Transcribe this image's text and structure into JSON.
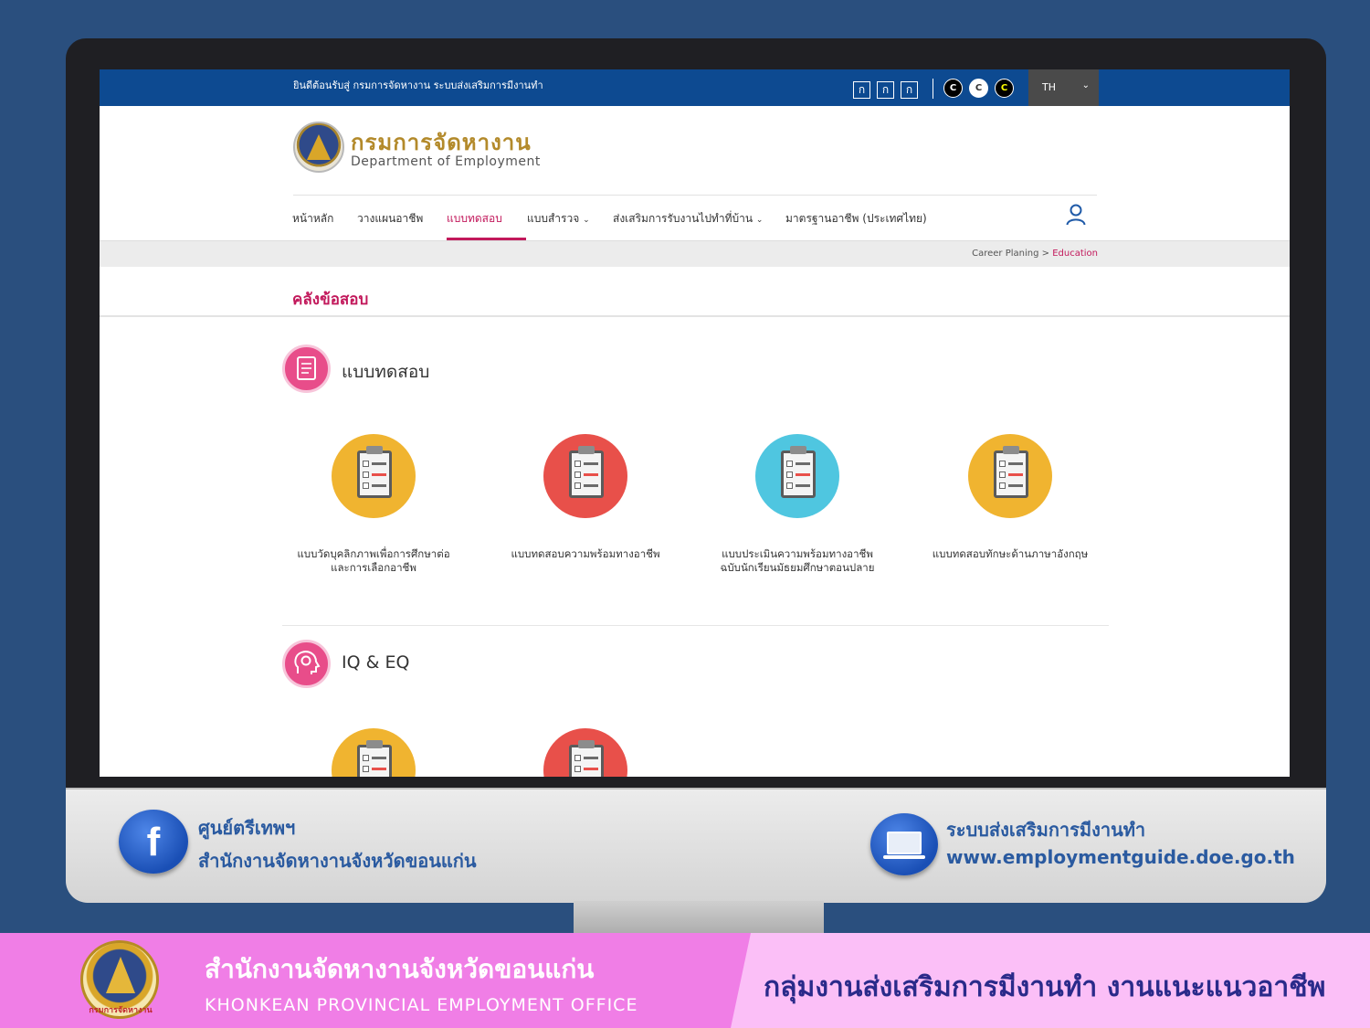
{
  "topbar": {
    "welcome": "ยินดีต้อนรับสู่ กรมการจัดหางาน ระบบส่งเสริมการมีงานทำ",
    "font_sizes": [
      "ก",
      "ก",
      "ก"
    ],
    "contrast": [
      "C",
      "C",
      "C"
    ],
    "language": "TH"
  },
  "brand": {
    "name_th": "กรมการจัดหางาน",
    "name_en": "Department of Employment"
  },
  "nav": {
    "items": [
      "หน้าหลัก",
      "วางแผนอาชีพ",
      "แบบทดสอบ",
      "แบบสำรวจ",
      "ส่งเสริมการรับงานไปทำที่บ้าน",
      "มาตรฐานอาชีพ (ประเทศไทย)"
    ],
    "active": "แบบทดสอบ"
  },
  "breadcrumb": {
    "parent": "Career Planing",
    "separator": ">",
    "current": "Education"
  },
  "page_title": "คลังข้อสอบ",
  "sections": [
    {
      "title": "แบบทดสอบ",
      "icon": "test-paper-icon",
      "cards": [
        {
          "label": "แบบวัดบุคลิกภาพเพื่อการศึกษาต่อและการเลือกอาชีพ",
          "color": "#f0b430"
        },
        {
          "label": "แบบทดสอบความพร้อมทางอาชีพ",
          "color": "#e8504a"
        },
        {
          "label": "แบบประเมินความพร้อมทางอาชีพ ฉบับนักเรียนมัธยมศึกษาตอนปลาย",
          "color": "#4fc6e0"
        },
        {
          "label": "แบบทดสอบทักษะด้านภาษาอังกฤษ",
          "color": "#f0b430"
        }
      ]
    },
    {
      "title": "IQ & EQ",
      "icon": "brain-gear-icon",
      "cards": [
        {
          "label": "",
          "color": "#f0b430"
        },
        {
          "label": "",
          "color": "#e8504a"
        }
      ]
    }
  ],
  "footer_bar": {
    "fb_line1": "ศูนย์ตรีเทพฯ",
    "fb_line2": "สำนักงานจัดหางานจังหวัดขอนแก่น",
    "web_line1": "ระบบส่งเสริมการมีงานทำ",
    "web_line2": "www.employmentguide.doe.go.th"
  },
  "banner": {
    "office_th": "สำนักงานจัดหางานจังหวัดขอนแก่น",
    "office_en": "KHONKEAN PROVINCIAL EMPLOYMENT OFFICE",
    "group": "กลุ่มงานส่งเสริมการมีงานทำ งานแนะแนวอาชีพ",
    "seal_text": "กรมการจัดหางาน"
  }
}
